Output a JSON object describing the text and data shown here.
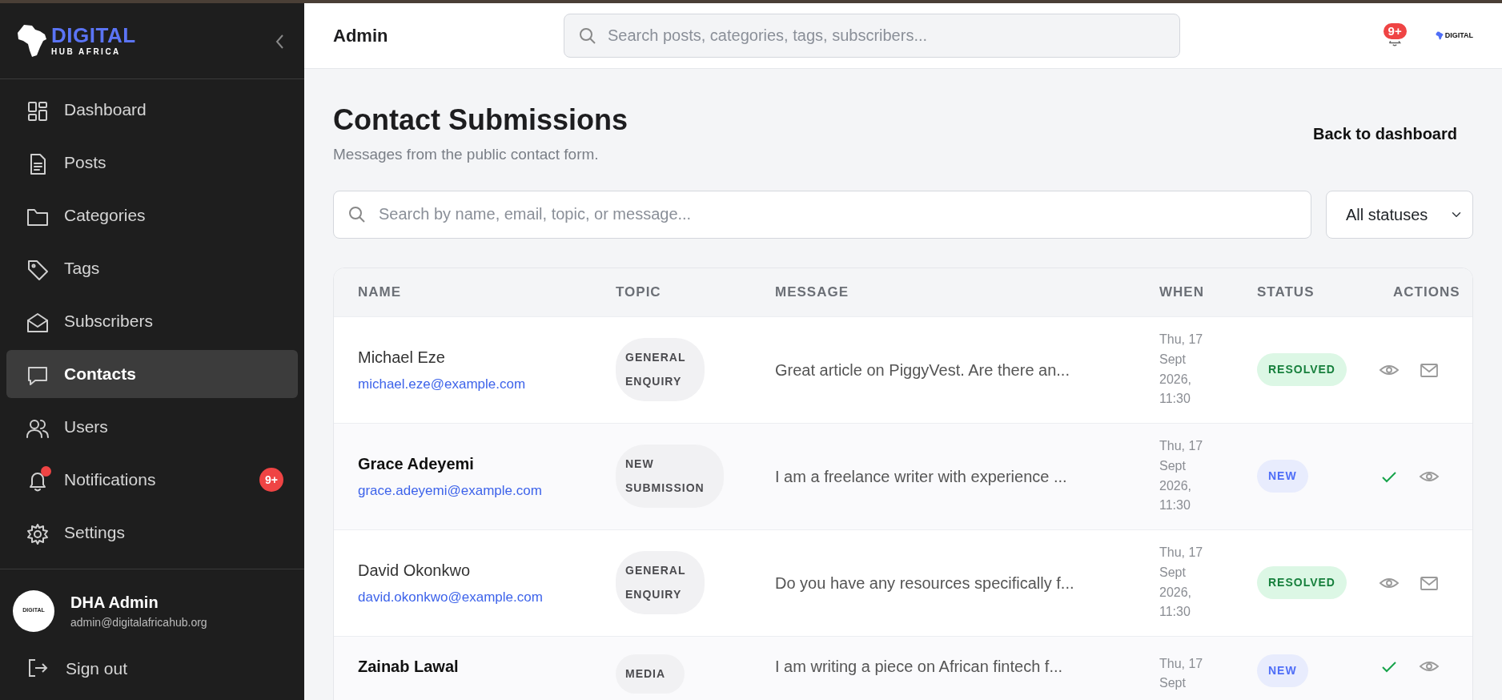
{
  "brand": {
    "name": "DIGITAL",
    "tagline": "HUB AFRICA"
  },
  "sidebar": {
    "items": [
      {
        "label": "Dashboard",
        "selected": false
      },
      {
        "label": "Posts",
        "selected": false
      },
      {
        "label": "Categories",
        "selected": false
      },
      {
        "label": "Tags",
        "selected": false
      },
      {
        "label": "Subscribers",
        "selected": false
      },
      {
        "label": "Contacts",
        "selected": true
      },
      {
        "label": "Users",
        "selected": false
      },
      {
        "label": "Notifications",
        "selected": false,
        "dot": true,
        "badge": "9+"
      },
      {
        "label": "Settings",
        "selected": false
      }
    ],
    "user": {
      "name": "DHA Admin",
      "email": "admin@digitalafricahub.org",
      "avatar_text": "DIGITAL"
    },
    "sign_out": "Sign out"
  },
  "header": {
    "title": "Admin",
    "search": {
      "placeholder": "Search posts, categories, tags, subscribers..."
    },
    "notification_badge": "9+",
    "logo_text": "DIGITAL"
  },
  "page": {
    "title": "Contact Submissions",
    "subtitle": "Messages from the public contact form.",
    "back_link": "Back to dashboard",
    "search": {
      "placeholder": "Search by name, email, topic, or message..."
    },
    "status_filter": "All statuses"
  },
  "table": {
    "columns": [
      "NAME",
      "TOPIC",
      "MESSAGE",
      "WHEN",
      "STATUS",
      "ACTIONS"
    ],
    "rows": [
      {
        "name": "Michael Eze",
        "email": "michael.eze@example.com",
        "unread": false,
        "topic": [
          "GENERAL",
          "ENQUIRY"
        ],
        "message": "Great article on PiggyVest. Are there an...",
        "when": [
          "Thu, 17",
          "Sept",
          "2026,",
          "11:30"
        ],
        "status": {
          "label": "RESOLVED",
          "kind": "resolved"
        },
        "actions": [
          {
            "kind": "view"
          },
          {
            "kind": "reply"
          }
        ]
      },
      {
        "name": "Grace Adeyemi",
        "email": "grace.adeyemi@example.com",
        "unread": true,
        "topic": [
          "NEW",
          "SUBMISSION"
        ],
        "message": "I am a freelance writer with experience ...",
        "when": [
          "Thu, 17",
          "Sept",
          "2026,",
          "11:30"
        ],
        "status": {
          "label": "NEW",
          "kind": "new"
        },
        "actions": [
          {
            "kind": "resolve"
          },
          {
            "kind": "view"
          }
        ]
      },
      {
        "name": "David Okonkwo",
        "email": "david.okonkwo@example.com",
        "unread": false,
        "topic": [
          "GENERAL",
          "ENQUIRY"
        ],
        "message": "Do you have any resources specifically f...",
        "when": [
          "Thu, 17",
          "Sept",
          "2026,",
          "11:30"
        ],
        "status": {
          "label": "RESOLVED",
          "kind": "resolved"
        },
        "actions": [
          {
            "kind": "view"
          },
          {
            "kind": "reply"
          }
        ]
      },
      {
        "name": "Zainab Lawal",
        "unread": true,
        "topic": [
          "MEDIA"
        ],
        "message": "I am writing a piece on African fintech f...",
        "when": [
          "Thu, 17",
          "Sept"
        ],
        "status": {
          "label": "NEW",
          "kind": "new"
        },
        "actions": [
          {
            "kind": "resolve"
          },
          {
            "kind": "view"
          }
        ]
      }
    ]
  }
}
